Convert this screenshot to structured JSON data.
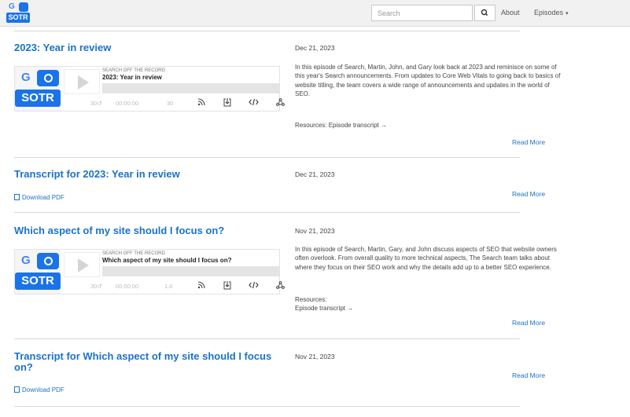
{
  "header": {
    "search_placeholder": "Search",
    "nav": [
      {
        "label": "About"
      },
      {
        "label": "Episodes",
        "caret": "▾"
      }
    ]
  },
  "logo": {
    "g": "G",
    "sotr": "SOTR"
  },
  "player_common": {
    "show_name": "SEARCH OFF THE RECORD",
    "back": "30↺",
    "forward": "30↻",
    "speed": "1x",
    "icons": [
      "rss-icon",
      "download-icon",
      "embed-icon",
      "share-icon"
    ]
  },
  "posts": [
    {
      "title": "2023: Year in review",
      "date": "Dec 21, 2023",
      "desc": "In this episode of Search, Martin, John, and Gary look back at 2023 and reminisce on some of this year's Search announcements. From updates to Core Web Vitals to going back to basics of website titling, the team covers a wide range of announcements and updates in the world of SEO.",
      "resources_label": "Resources:",
      "resources_link": "Episode transcript →",
      "read_more": "Read More",
      "player": {
        "episode": "2023: Year in review",
        "time": "00:00:00",
        "rate": "30"
      }
    },
    {
      "title": "Transcript for 2023: Year in review",
      "date": "Dec 21, 2023",
      "pdf": "Download PDF",
      "read_more": "Read More"
    },
    {
      "title": "Which aspect of my site should I focus on?",
      "date": "Nov 21, 2023",
      "desc": "In this episode of Search, Martin, Gary, and John discuss aspects of SEO that website owners often overlook. From overall quality to more technical aspects, The Search team talks about where they focus on their SEO work and why the details add up to a better SEO experience.",
      "resources_label": "Resources:",
      "resources_link": "Episode transcript →",
      "read_more": "Read More",
      "player": {
        "episode": "Which aspect of my site should I focus on?",
        "time": "00:00:00",
        "rate": "1.0"
      }
    },
    {
      "title": "Transcript for Which aspect of my site should I focus on?",
      "date": "Nov 21, 2023",
      "pdf": "Download PDF",
      "read_more": "Read More"
    }
  ]
}
